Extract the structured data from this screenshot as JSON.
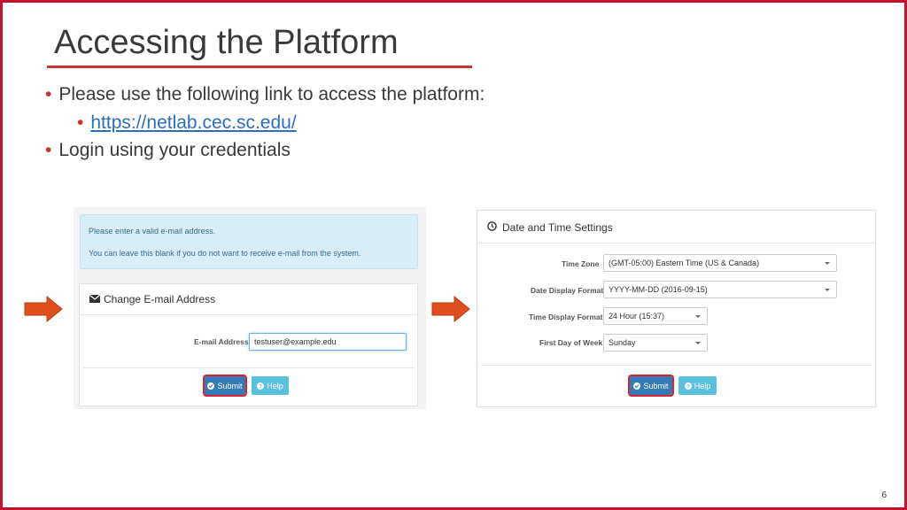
{
  "slide": {
    "title": "Accessing the Platform",
    "bullets": [
      "Please use the following link to access the platform:",
      "https://netlab.cec.sc.edu/",
      "Login using your credentials"
    ],
    "page_number": "6",
    "accent_color": "#c8102e"
  },
  "email_panel": {
    "alert_lines": [
      "Please enter a valid e-mail address.",
      "You can leave this blank if you do not want to receive e-mail from the system."
    ],
    "title": "Change E-mail Address",
    "email_label": "E-mail Address",
    "email_value": "testuser@example.edu",
    "submit_label": "Submit",
    "help_label": "Help",
    "icons": [
      "envelope-icon",
      "check-circle-icon",
      "question-circle-icon"
    ]
  },
  "datetime_panel": {
    "title": "Date and Time Settings",
    "fields": [
      {
        "label": "Time Zone",
        "value": "(GMT-05:00) Eastern Time (US & Canada)"
      },
      {
        "label": "Date Display Format",
        "value": "YYYY-MM-DD (2016-09-15)"
      },
      {
        "label": "Time Display Format",
        "value": "24 Hour (15:37)"
      },
      {
        "label": "First Day of Week",
        "value": "Sunday"
      }
    ],
    "submit_label": "Submit",
    "help_label": "Help",
    "icons": [
      "clock-icon",
      "check-circle-icon",
      "question-circle-icon"
    ]
  }
}
